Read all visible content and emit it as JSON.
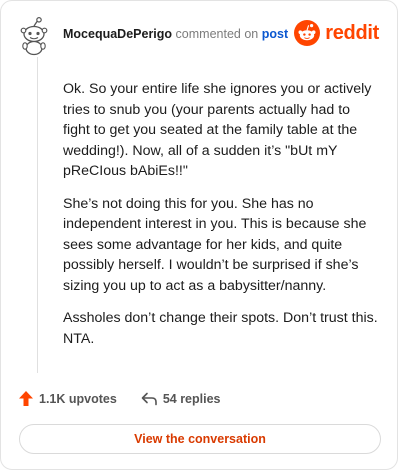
{
  "header": {
    "username": "MocequaDePerigo",
    "action_text": "commented on",
    "post_link": "post"
  },
  "brand": {
    "wordmark": "reddit",
    "logo_icon": "reddit-alien-icon",
    "color": "#ff4500"
  },
  "comment": {
    "paragraphs": [
      "Ok. So your entire life she ignores you or actively tries to snub you (your parents actually had to fight to get you seated at the family table at the wedding!). Now, all of a sudden it’s \"bUt mY pReCIous bAbiEs!!\"",
      "She’s not doing this for you. She has no independent interest in you. This is because she sees some advantage for her kids, and quite possibly herself. I wouldn’t be surprised if she’s sizing you up to act as a babysitter/nanny.",
      "Assholes don’t change their spots. Don’t trust this. NTA."
    ]
  },
  "meta": {
    "upvotes": "1.1K upvotes",
    "upvote_icon": "upvote-arrow-icon",
    "upvote_color": "#ff4500",
    "replies": "54 replies",
    "reply_icon": "reply-arrow-icon"
  },
  "cta": {
    "label": "View the conversation",
    "color": "#d93a00"
  }
}
